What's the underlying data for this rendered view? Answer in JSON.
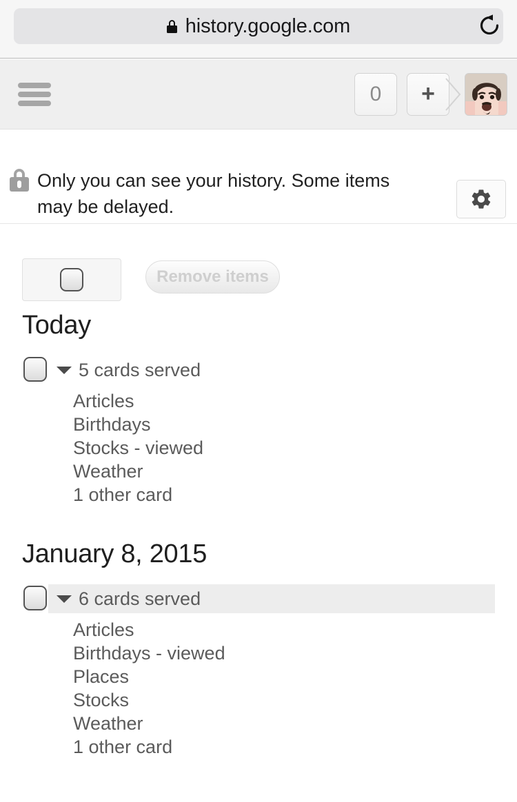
{
  "browser": {
    "url": "history.google.com",
    "lock_icon": "lock-icon",
    "reload_icon": "reload-icon",
    "menu_icon": "hamburger-menu-icon",
    "tab_count": "0",
    "new_tab_label": "+",
    "avatar_label": "profile-avatar"
  },
  "notice": {
    "lock_icon": "lock-icon",
    "text": "Only you can see your history. Some items may be delayed.",
    "settings_icon": "gear-icon"
  },
  "actions": {
    "select_all_label": "select-all-checkbox",
    "remove_label": "Remove items",
    "remove_disabled": true
  },
  "sections": [
    {
      "title": "Today",
      "highlighted": false,
      "group_label": "5 cards served",
      "cards": [
        "Articles",
        "Birthdays",
        "Stocks - viewed",
        "Weather",
        "1 other card"
      ]
    },
    {
      "title": "January 8, 2015",
      "highlighted": true,
      "group_label": "6 cards served",
      "cards": [
        "Articles",
        "Birthdays - viewed",
        "Places",
        "Stocks",
        "Weather",
        "1 other card"
      ]
    }
  ],
  "colors": {
    "chrome_bg": "#f6f6f6",
    "toolbar_bg": "#efefef",
    "url_bar_bg": "#e4e4e6",
    "highlight_bg": "#ededed",
    "text_primary": "#1f1f1f",
    "text_secondary": "#5b5b5b",
    "disabled_text": "#cfcfcf"
  }
}
